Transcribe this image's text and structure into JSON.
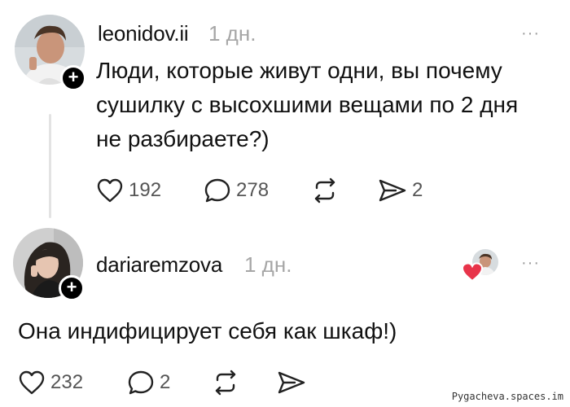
{
  "post": {
    "username": "leonidov.ii",
    "time": "1 дн.",
    "text_lines": [
      "Люди, которые живут одни, вы почему",
      "сушилку с высохшими вещами по 2 дня",
      "не разбираете?)"
    ],
    "likes": "192",
    "comments": "278",
    "shares": "2",
    "more": "···",
    "add": "+"
  },
  "reply": {
    "username": "dariaremzova",
    "time": "1 дн.",
    "text": "Она индифицирует себя как шкаф!)",
    "likes": "232",
    "comments": "2",
    "more": "···",
    "add": "+"
  },
  "watermark": "Pygacheva.spaces.im",
  "colors": {
    "text": "#111111",
    "muted": "#a6a6a6",
    "heart": "#e8344a",
    "thread_line": "#e3e3e3"
  },
  "icons": [
    "heart-icon",
    "comment-icon",
    "repost-icon",
    "send-icon",
    "more-icon",
    "plus-icon"
  ]
}
